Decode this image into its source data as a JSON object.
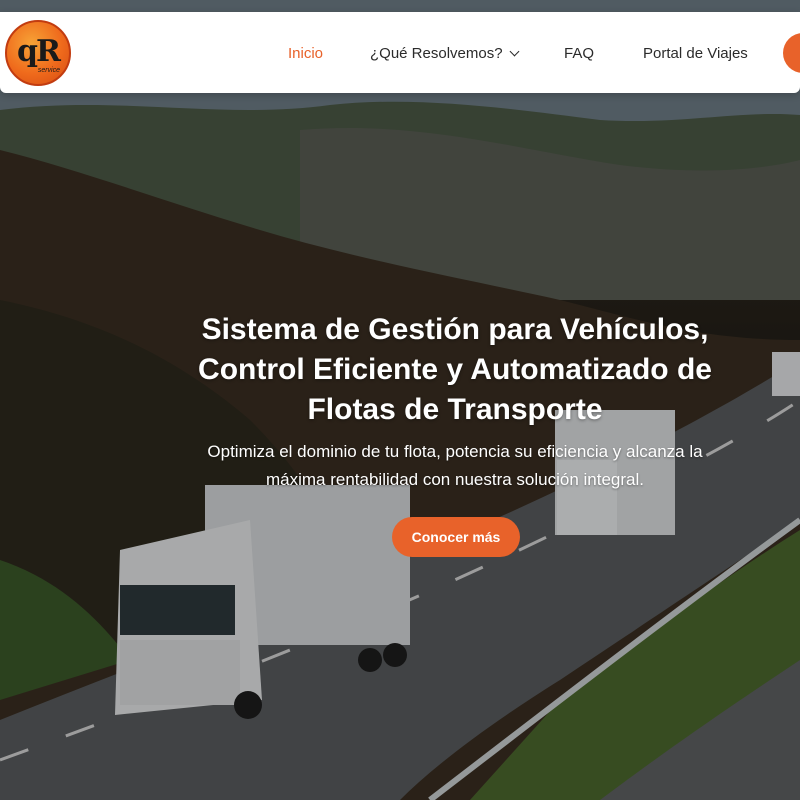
{
  "header": {
    "logo_text": "qR",
    "logo_sub": "service",
    "nav": [
      {
        "label": "Inicio",
        "active": true
      },
      {
        "label": "¿Qué Resolvemos?",
        "has_dropdown": true
      },
      {
        "label": "FAQ"
      },
      {
        "label": "Portal de Viajes"
      }
    ]
  },
  "hero": {
    "title_lines": [
      "Sistema de Gestión para Vehículos,",
      "Control Eficiente y Automatizado de",
      "Flotas de Transporte"
    ],
    "subtitle_lines": [
      "Optimiza el dominio de tu flota, potencia su eficiencia y alcanza la",
      "máxima rentabilidad con nuestra solución integral."
    ],
    "cta_label": "Conocer más"
  },
  "colors": {
    "accent": "#e8622a",
    "header_bg": "#ffffff",
    "nav_text": "#2b2b2b"
  }
}
